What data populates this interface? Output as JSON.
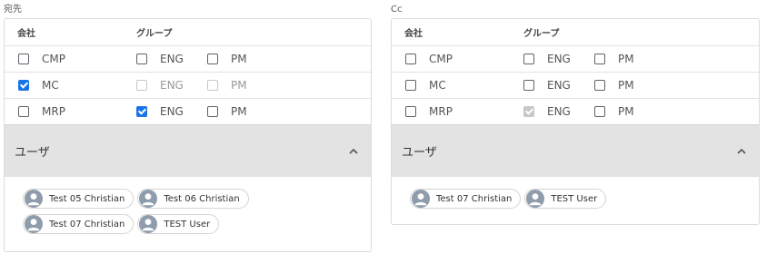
{
  "to": {
    "section_label": "宛先",
    "header": {
      "company": "会社",
      "group": "グループ"
    },
    "rows": [
      {
        "company": "CMP",
        "company_checked": false,
        "groups": [
          {
            "label": "ENG",
            "checked": false,
            "disabled": false
          },
          {
            "label": "PM",
            "checked": false,
            "disabled": false
          }
        ]
      },
      {
        "company": "MC",
        "company_checked": true,
        "groups": [
          {
            "label": "ENG",
            "checked": false,
            "disabled": true
          },
          {
            "label": "PM",
            "checked": false,
            "disabled": true
          }
        ]
      },
      {
        "company": "MRP",
        "company_checked": false,
        "groups": [
          {
            "label": "ENG",
            "checked": true,
            "disabled": false
          },
          {
            "label": "PM",
            "checked": false,
            "disabled": false
          }
        ]
      }
    ],
    "users_title": "ユーザ",
    "users": [
      "Test 05 Christian",
      "Test 06 Christian",
      "Test 07 Christian",
      "TEST User"
    ]
  },
  "cc": {
    "section_label": "Cc",
    "header": {
      "company": "会社",
      "group": "グループ"
    },
    "rows": [
      {
        "company": "CMP",
        "company_checked": false,
        "groups": [
          {
            "label": "ENG",
            "checked": false,
            "disabled": false
          },
          {
            "label": "PM",
            "checked": false,
            "disabled": false
          }
        ]
      },
      {
        "company": "MC",
        "company_checked": false,
        "groups": [
          {
            "label": "ENG",
            "checked": false,
            "disabled": false
          },
          {
            "label": "PM",
            "checked": false,
            "disabled": false
          }
        ]
      },
      {
        "company": "MRP",
        "company_checked": false,
        "groups": [
          {
            "label": "ENG",
            "checked": true,
            "disabled": true
          },
          {
            "label": "PM",
            "checked": false,
            "disabled": false
          }
        ]
      }
    ],
    "users_title": "ユーザ",
    "users": [
      "Test 07 Christian",
      "TEST User"
    ]
  },
  "colors": {
    "accent": "#1a73e8",
    "panel_header": "#e3e3e3",
    "avatar": "#8e9cab"
  },
  "icons": {
    "expand": "chevron-up-icon",
    "avatar": "user-avatar-icon"
  }
}
